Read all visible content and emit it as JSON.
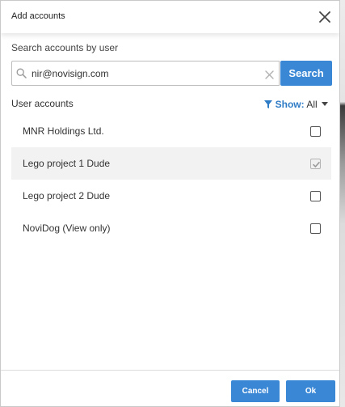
{
  "dialog": {
    "title": "Add accounts"
  },
  "search": {
    "label": "Search accounts by user",
    "value": "nir@novisign.com",
    "button_label": "Search"
  },
  "accounts": {
    "label": "User accounts",
    "filter": {
      "show_label": "Show:",
      "value": "All"
    },
    "items": [
      {
        "label": "MNR Holdings Ltd.",
        "checked": false,
        "selected": false
      },
      {
        "label": "Lego project 1 Dude",
        "checked": true,
        "selected": true
      },
      {
        "label": "Lego project 2 Dude",
        "checked": false,
        "selected": false
      },
      {
        "label": "NoviDog (View only)",
        "checked": false,
        "selected": false
      }
    ]
  },
  "footer": {
    "cancel_label": "Cancel",
    "ok_label": "Ok"
  },
  "colors": {
    "accent": "#3a87d6",
    "link": "#2e7bc6",
    "row_selected": "#f2f2f2"
  }
}
